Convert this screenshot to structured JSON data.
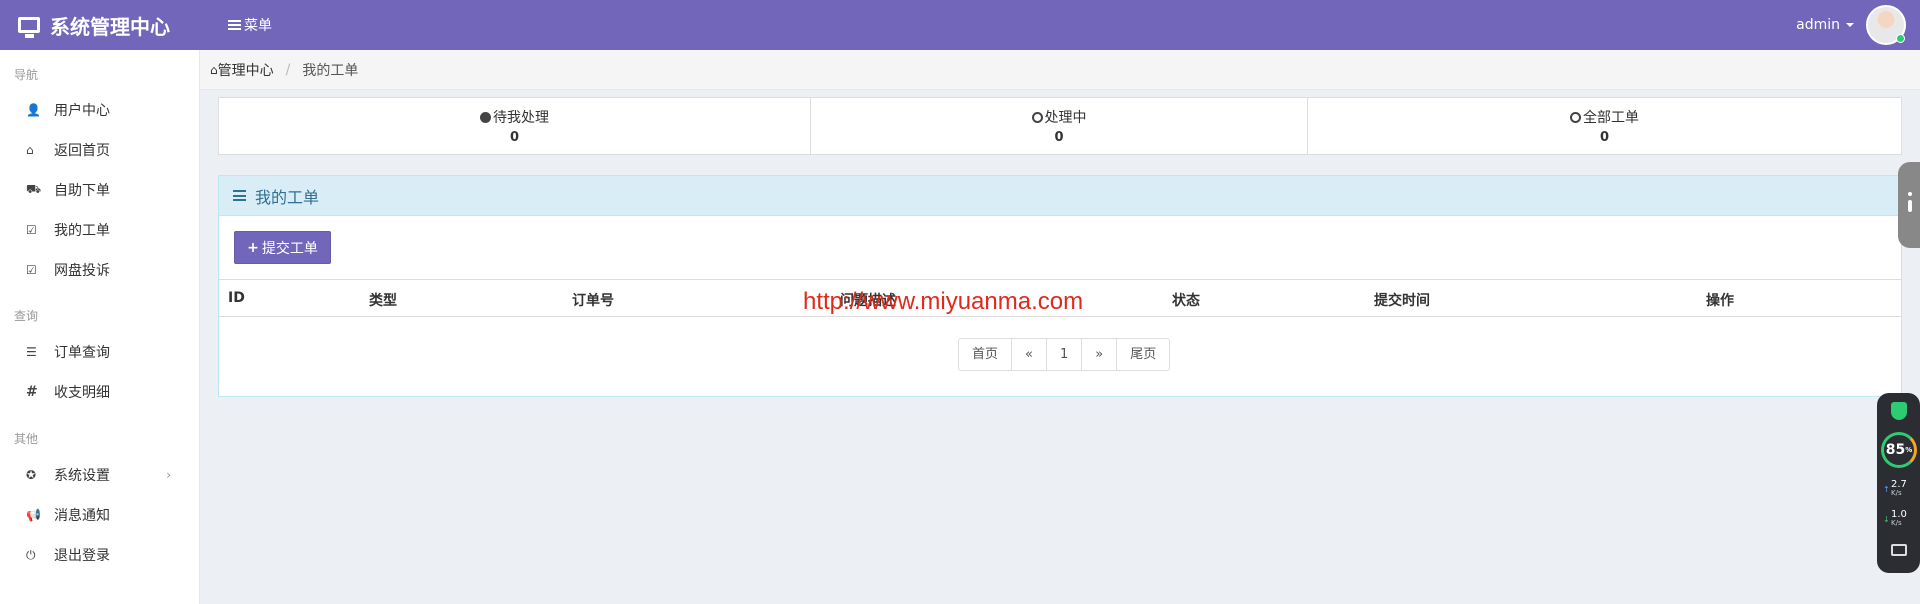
{
  "header": {
    "brand": "系统管理中心",
    "menu_label": "菜单",
    "username": "admin"
  },
  "sidebar": {
    "groups": [
      {
        "title": "导航",
        "items": [
          {
            "label": "用户中心",
            "icon": "user-icon"
          },
          {
            "label": "返回首页",
            "icon": "home-icon"
          },
          {
            "label": "自助下单",
            "icon": "cart-icon"
          },
          {
            "label": "我的工单",
            "icon": "check-square-icon"
          },
          {
            "label": "网盘投诉",
            "icon": "check-square-icon"
          }
        ]
      },
      {
        "title": "查询",
        "items": [
          {
            "label": "订单查询",
            "icon": "list-icon"
          },
          {
            "label": "收支明细",
            "icon": "hash-icon"
          }
        ]
      },
      {
        "title": "其他",
        "items": [
          {
            "label": "系统设置",
            "icon": "rebel-icon"
          },
          {
            "label": "消息通知",
            "icon": "bullhorn-icon"
          },
          {
            "label": "退出登录",
            "icon": "power-icon"
          }
        ]
      }
    ]
  },
  "breadcrumb": {
    "home": "管理中心",
    "current": "我的工单"
  },
  "stats": [
    {
      "label": "待我处理",
      "value": "0",
      "icon": "exclamation-circle-icon"
    },
    {
      "label": "处理中",
      "value": "0",
      "icon": "clock-icon"
    },
    {
      "label": "全部工单",
      "value": "0",
      "icon": "check-circle-icon"
    }
  ],
  "panel": {
    "title": "我的工单",
    "submit_label": "提交工单"
  },
  "table": {
    "columns": [
      "ID",
      "类型",
      "订单号",
      "问题描述",
      "状态",
      "提交时间",
      "操作"
    ]
  },
  "pagination": {
    "first": "首页",
    "prev": "«",
    "page": "1",
    "next": "»",
    "last": "尾页"
  },
  "watermark": "http://www.miyuanma.com",
  "monitor": {
    "percent": "85",
    "percent_unit": "%",
    "up_speed": "2.7",
    "down_speed": "1.0",
    "speed_unit": "K/s"
  },
  "colors": {
    "topbar": "#7266ba",
    "panel_head": "#d9edf7",
    "watermark": "#e0291b"
  }
}
